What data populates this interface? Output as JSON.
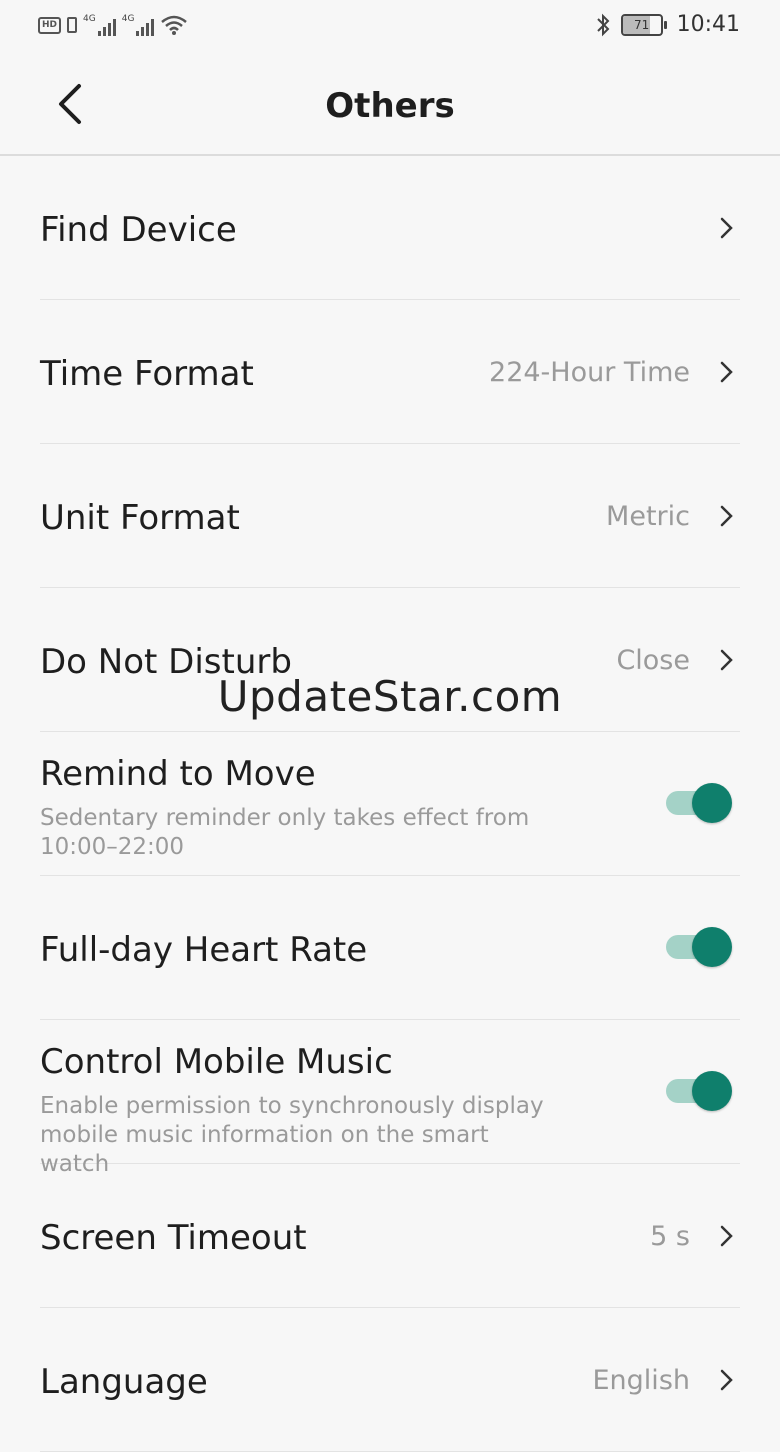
{
  "status_bar": {
    "left_badge": "HD",
    "network_1": "4G",
    "network_2": "4G",
    "battery_level": "71",
    "time": "10:41"
  },
  "header": {
    "title": "Others"
  },
  "settings": [
    {
      "label": "Find Device"
    },
    {
      "label": "Time Format",
      "value": "224-Hour Time"
    },
    {
      "label": "Unit Format",
      "value": "Metric"
    },
    {
      "label": "Do Not Disturb",
      "value": "Close"
    },
    {
      "label": "Remind to Move",
      "sub": "Sedentary reminder only takes effect from 10:00–22:00",
      "toggle_on": true
    },
    {
      "label": "Full-day Heart Rate",
      "toggle_on": true
    },
    {
      "label": "Control Mobile Music",
      "sub": "Enable permission to synchronously display mobile music information on the smart watch",
      "toggle_on": true
    },
    {
      "label": "Screen Timeout",
      "value": "5 s"
    },
    {
      "label": "Language",
      "value": "English"
    }
  ],
  "watermark": "UpdateStar.com",
  "colors": {
    "accent": "#0f7f6c",
    "track": "#a4d2c7",
    "background": "#f7f7f7"
  }
}
